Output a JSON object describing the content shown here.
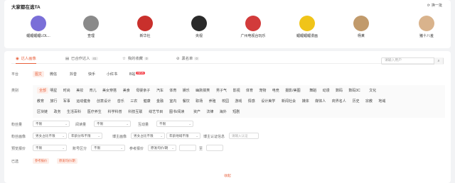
{
  "header": {
    "title": "大家都在选TA",
    "refresh_label": "换一批"
  },
  "creators": [
    {
      "name": "鲤鲤鲤鲤LOL...",
      "color": "#7a6fd8"
    },
    {
      "name": "查理",
      "color": "#8a8a8a"
    },
    {
      "name": "新华社",
      "color": "#c9302c"
    },
    {
      "name": "央视",
      "color": "#2a2a2a"
    },
    {
      "name": "广州电视台玩乐",
      "color": "#d23b3b"
    },
    {
      "name": "鲤鲤鲤鲤漫画",
      "color": "#f0c419"
    },
    {
      "name": "杨某",
      "color": "#c19a6b"
    },
    {
      "name": "猪十八羞",
      "color": "#d9b38c"
    }
  ],
  "tabs": [
    {
      "label": "达人画像",
      "count": "",
      "active": true,
      "icon": "fire-icon"
    },
    {
      "label": "已合作达人",
      "count": "41",
      "active": false,
      "icon": "list-icon"
    },
    {
      "label": "我的收藏",
      "count": "0",
      "active": false,
      "icon": "star-icon"
    },
    {
      "label": "黑名单",
      "count": "0",
      "active": false,
      "icon": "block-icon"
    }
  ],
  "search": {
    "placeholder": "请输入用户"
  },
  "platform": {
    "label": "平台",
    "options": [
      "图文",
      "微信",
      "抖音",
      "快手",
      "小红书",
      "B站"
    ],
    "new_tag": "NEW"
  },
  "category": {
    "label": "类别",
    "row1": [
      "全部",
      "明星",
      "时尚",
      "美妆",
      "育儿",
      "美女穿搭",
      "美食",
      "母婴亲子",
      "汽车",
      "体育",
      "娱乐",
      "幽默搞笑",
      "男子气",
      "影视",
      "体育",
      "宠物",
      "电竞",
      "摄影/美图",
      "舞蹈",
      "动漫",
      "数码",
      "数码3C",
      "文化"
    ],
    "row2": [
      "教育",
      "旅行",
      "军事",
      "运动健身",
      "创意设计",
      "音乐",
      "三农",
      "健康",
      "金融",
      "室内",
      "餐饮",
      "职场",
      "养殖",
      "校园",
      "游戏",
      "情感",
      "设计美学",
      "新闻社会",
      "媒体",
      "媒体人",
      "商界名人",
      "历史",
      "宗教",
      "地域"
    ],
    "row3": [
      "区块链",
      "政务",
      "生活百科",
      "医疗养生",
      "科学科普",
      "科技互联",
      "综艺节目",
      "图书/阅读",
      "资产",
      "法律",
      "海外",
      "短剧"
    ]
  },
  "filters": {
    "fans": {
      "label": "粉丝量",
      "value": "不限"
    },
    "reads": {
      "label": "阅读量",
      "value": "不限"
    },
    "interact": {
      "label": "互动量",
      "value": "不限"
    },
    "audience": {
      "label": "粉丝画像",
      "gender": "男女占比不限",
      "age": "年龄分布不限",
      "region_label": "博主画像",
      "region": "男女占比不限",
      "region2": "年龄地域不限",
      "verify_label": "博主认证信息",
      "verify_placeholder": "请输入认证"
    },
    "expected": {
      "label": "预览报价",
      "value": "不限",
      "account_label": "账号区分",
      "account": "不限",
      "price_label": "参考报价",
      "price_type": "原发均价/期",
      "range_sep": "至"
    },
    "selected": {
      "label": "已选",
      "chips": [
        "参考报价",
        "原发均价/期"
      ]
    }
  },
  "collapse_label": "收起",
  "accent": "#e8603c"
}
